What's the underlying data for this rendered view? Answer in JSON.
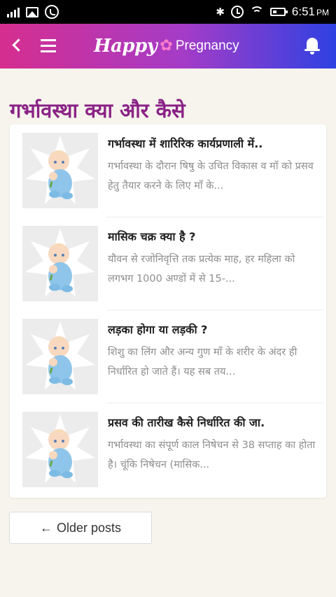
{
  "status_bar": {
    "time": "6:51",
    "ampm": "PM",
    "bluetooth_glyph": "✱",
    "icons": [
      "signal-icon",
      "gallery-icon",
      "whatsapp-icon",
      "bluetooth-icon",
      "alarm-icon",
      "wifi-icon",
      "battery-icon"
    ]
  },
  "header": {
    "brand_happy": "Happy",
    "brand_flower": "✿",
    "brand_pregnancy": "Pregnancy",
    "gradient": [
      "#d62e8f",
      "#a43cc8",
      "#2e41e2"
    ]
  },
  "page_title": "गर्भावस्था क्या और कैसे",
  "posts": [
    {
      "title": "गर्भावस्था में शारिरिक कार्यप्रणाली में..",
      "excerpt": "गर्भावस्था के दौरान षिषु के उचित विकास व मॉ को प्रसव हेतु तैयार करने के लिए माँ के..."
    },
    {
      "title": "मासिक चक्र क्या है ?",
      "excerpt": "यौवन से रजोनिवृत्ति तक प्रत्येक माह, हर महिला को लगभग 1000 अण्डों में से 15-..."
    },
    {
      "title": "लड़का होगा या लड़की ?",
      "excerpt": "शिशु का लिंग और अन्य गुण माँ के शरीर के अंदर ही निर्धारित हो जाते हैं। यह सब तय..."
    },
    {
      "title": "प्रसव की तारीख कैसे निर्धारित की जा.",
      "excerpt": "गर्भावस्था का संपूर्ण काल निषेचन से 38 सप्ताह का होता है। चूंकि निषेचन (मासिक..."
    }
  ],
  "older_posts": {
    "arrow": "←",
    "label": "Older posts"
  },
  "colors": {
    "title": "#8a2286",
    "background": "#f6f4ec",
    "excerpt": "#8e8e8e"
  }
}
